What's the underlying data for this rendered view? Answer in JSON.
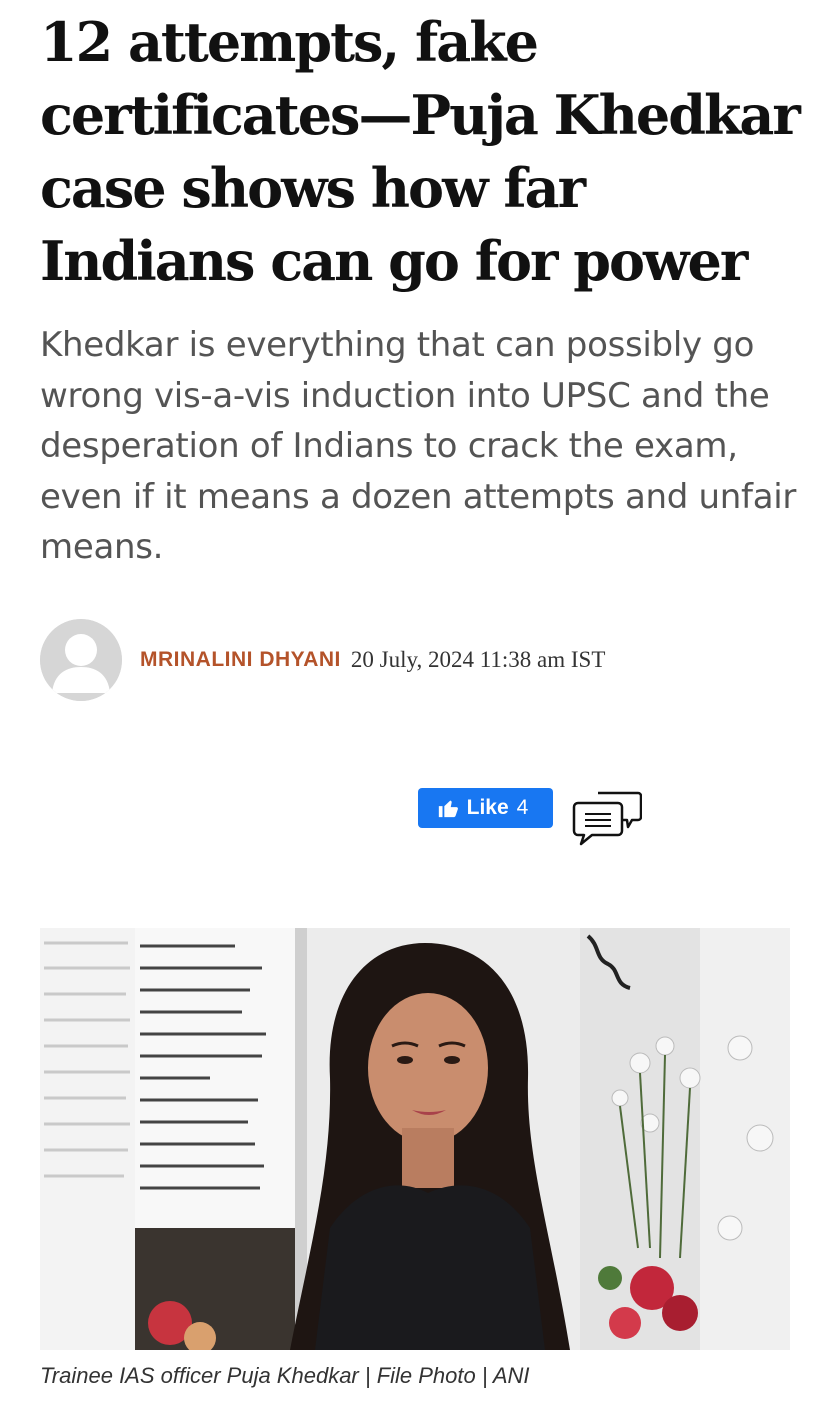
{
  "article": {
    "headline": "12 attempts, fake certificates—Puja Khedkar case shows how far Indians can go for power",
    "subhead": "Khedkar is everything that can possibly go wrong vis-a-vis induction into UPSC and the desperation of Indians to crack the exam, even if it means a dozen attempts and unfair means.",
    "author": "MRINALINI DHYANI",
    "date": "20 July, 2024 11:38 am IST",
    "caption": "Trainee IAS officer Puja Khedkar | File Photo | ANI"
  },
  "social": {
    "like_label": "Like",
    "like_count": "4"
  },
  "icons": {
    "avatar": "default-user-icon",
    "like": "thumbs-up-icon",
    "comments": "comment-bubbles-icon"
  },
  "colors": {
    "author": "#b4532a",
    "like_button": "#1877f2",
    "subhead": "#545454"
  }
}
